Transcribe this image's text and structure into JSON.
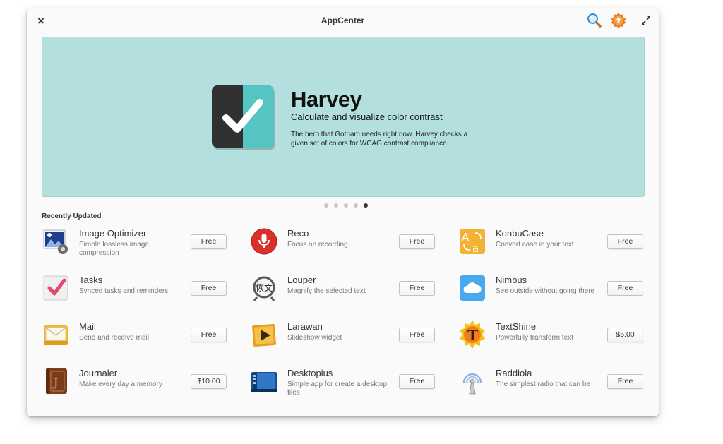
{
  "window": {
    "title": "AppCenter",
    "close_glyph": "×"
  },
  "icons": {
    "close": "close-icon",
    "search": "search-icon",
    "updates": "updates-badge-icon",
    "maximize": "maximize-icon"
  },
  "banner": {
    "name": "Harvey",
    "summary": "Calculate and visualize color contrast",
    "description": "The hero that Gotham needs right now. Harvey checks a given set of colors for WCAG contrast compliance.",
    "color": "#b3dfdf",
    "page_count": 5,
    "active_page": 5
  },
  "recently_updated": {
    "title": "Recently Updated",
    "apps": [
      {
        "name": "Image Optimizer",
        "summary": "Simple lossless image compression",
        "price": "Free",
        "icon": "image-optimizer-icon"
      },
      {
        "name": "Reco",
        "summary": "Focus on recording",
        "price": "Free",
        "icon": "microphone-icon"
      },
      {
        "name": "KonbuCase",
        "summary": "Convert case in your text",
        "price": "Free",
        "icon": "text-case-icon"
      },
      {
        "name": "Tasks",
        "summary": "Synced tasks and reminders",
        "price": "Free",
        "icon": "checkmark-icon"
      },
      {
        "name": "Louper",
        "summary": "Magnify the selected text",
        "price": "Free",
        "icon": "magnifier-icon"
      },
      {
        "name": "Nimbus",
        "summary": "See outside without going there",
        "price": "Free",
        "icon": "cloud-icon"
      },
      {
        "name": "Mail",
        "summary": "Send and receive mail",
        "price": "Free",
        "icon": "mail-icon"
      },
      {
        "name": "Larawan",
        "summary": "Slideshow widget",
        "price": "Free",
        "icon": "slideshow-icon"
      },
      {
        "name": "TextShine",
        "summary": "Powerfully transform text",
        "price": "$5.00",
        "icon": "textshine-icon"
      },
      {
        "name": "Journaler",
        "summary": "Make every day a memory",
        "price": "$10.00",
        "icon": "journal-icon"
      },
      {
        "name": "Desktopius",
        "summary": "Simple app for create a desktop files",
        "price": "Free",
        "icon": "desktop-file-icon"
      },
      {
        "name": "Raddiola",
        "summary": "The simplest radio that can be",
        "price": "Free",
        "icon": "radio-icon"
      }
    ]
  }
}
